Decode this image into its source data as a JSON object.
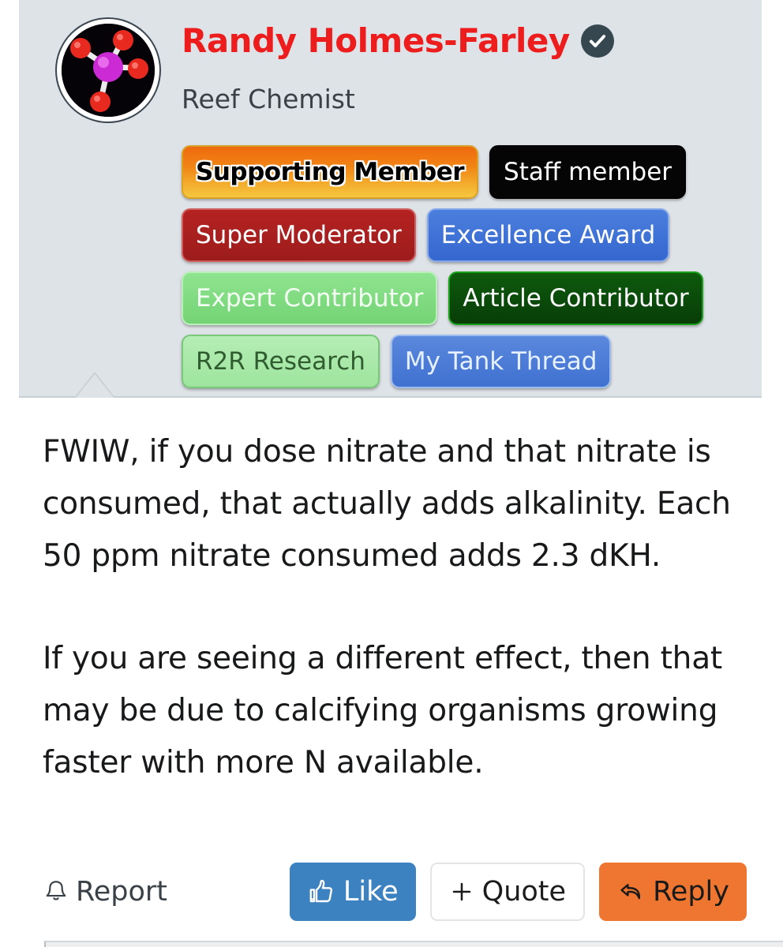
{
  "user": {
    "name": "Randy Holmes-Farley",
    "name_color": "#ee1d1d",
    "title": "Reef Chemist",
    "verified": true,
    "verified_icon": "check-circle-icon",
    "avatar_icon": "molecule-avatar-icon",
    "avatar": {
      "background": "#050208",
      "center_atom_color": "#cc2ad4",
      "outer_atom_color": "#e8291f",
      "bond_color": "#ffffff"
    }
  },
  "badges": [
    [
      {
        "label": "Supporting Member",
        "style": "supporting",
        "bg": "#f08315",
        "fg": "#000000"
      },
      {
        "label": "Staff member",
        "style": "staff",
        "bg": "#050505",
        "fg": "#ffffff"
      }
    ],
    [
      {
        "label": "Super Moderator",
        "style": "supermod",
        "bg": "#b52222",
        "fg": "#ffffff"
      },
      {
        "label": "Excellence Award",
        "style": "excellence",
        "bg": "#4b7fdd",
        "fg": "#ffffff"
      }
    ],
    [
      {
        "label": "Expert Contributor",
        "style": "expert",
        "bg": "#8fe48f",
        "fg": "#f4fff4"
      },
      {
        "label": "Article Contributor",
        "style": "article",
        "bg": "#0d5a0d",
        "fg": "#ffffff"
      }
    ],
    [
      {
        "label": "R2R Research",
        "style": "r2r",
        "bg": "#b5edb5",
        "fg": "#305c30"
      },
      {
        "label": "My Tank Thread",
        "style": "mytank",
        "bg": "#5b88dd",
        "fg": "#e6f0ff"
      }
    ]
  ],
  "post": {
    "paragraphs": [
      "FWIW, if you dose nitrate and that nitrate is consumed, that actually adds alkalinity. Each 50 ppm nitrate consumed adds 2.3 dKH.",
      "If you are seeing a different effect, then that may be due to calcifying organisms growing faster with more N available."
    ]
  },
  "actions": {
    "report": {
      "label": "Report",
      "icon": "bell-icon"
    },
    "like": {
      "label": "Like",
      "icon": "thumbs-up-icon",
      "bg": "#3c82c0",
      "fg": "#ffffff"
    },
    "quote": {
      "label": "Quote",
      "icon": "plus-icon",
      "bg": "#ffffff",
      "fg": "#1c1c1c"
    },
    "reply": {
      "label": "Reply",
      "icon": "reply-arrow-icon",
      "bg": "#ef7631",
      "fg": "#1a1a1a"
    }
  },
  "theme": {
    "card_background": "#dee3e7",
    "page_background": "#ffffff"
  }
}
